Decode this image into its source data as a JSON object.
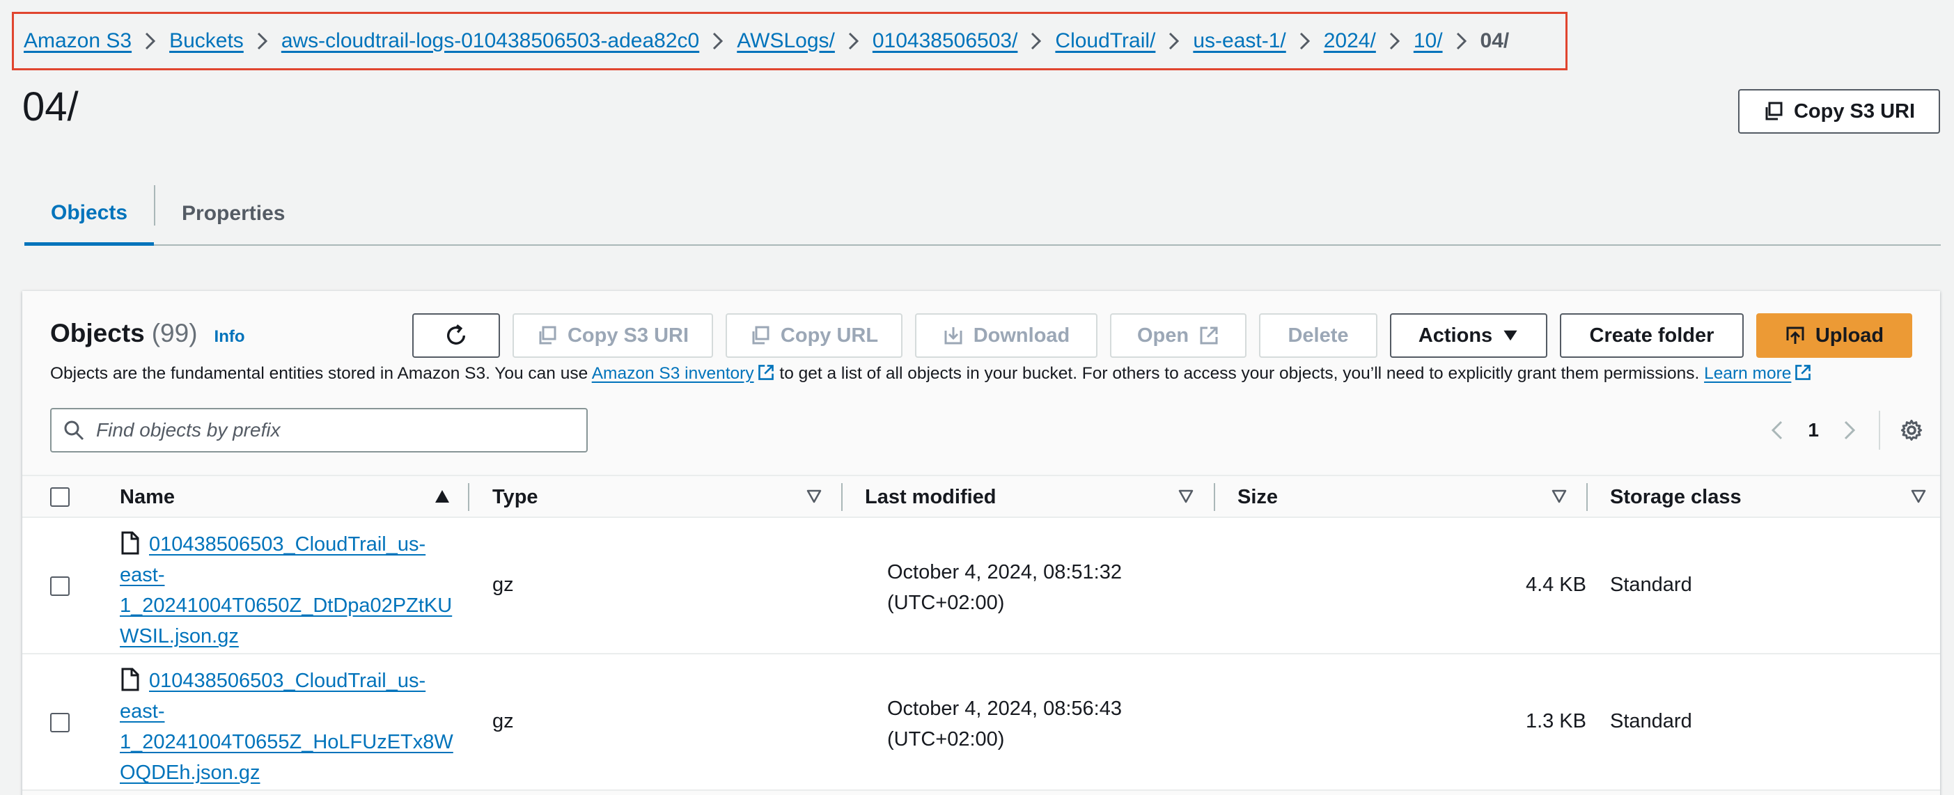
{
  "breadcrumb": {
    "items": [
      "Amazon S3",
      "Buckets",
      "aws-cloudtrail-logs-010438506503-adea82c0",
      "AWSLogs/",
      "010438506503/",
      "CloudTrail/",
      "us-east-1/",
      "2024/",
      "10/"
    ],
    "current": "04/"
  },
  "page": {
    "title": "04/",
    "copy_uri_label": "Copy S3 URI"
  },
  "tabs": [
    {
      "label": "Objects",
      "active": true
    },
    {
      "label": "Properties",
      "active": false
    }
  ],
  "objects_panel": {
    "title": "Objects",
    "count": "(99)",
    "info_label": "Info",
    "toolbar": {
      "copy_s3_uri": "Copy S3 URI",
      "copy_url": "Copy URL",
      "download": "Download",
      "open": "Open",
      "delete": "Delete",
      "actions": "Actions",
      "create_folder": "Create folder",
      "upload": "Upload"
    },
    "description": {
      "part1": "Objects are the fundamental entities stored in Amazon S3. You can use ",
      "link1": "Amazon S3 inventory",
      "part2": " to get a list of all objects in your bucket. For others to access your objects, you’ll need to explicitly grant them permissions. ",
      "link2": "Learn more"
    },
    "search": {
      "placeholder": "Find objects by prefix",
      "value": ""
    },
    "pagination": {
      "current_page": "1"
    }
  },
  "table": {
    "columns": [
      "Name",
      "Type",
      "Last modified",
      "Size",
      "Storage class"
    ],
    "sorted_column": "Name",
    "rows": [
      {
        "name": "010438506503_CloudTrail_us-east-1_20241004T0650Z_DtDpa02PZtKUWSIL.json.gz",
        "name_lines": [
          "010438506503_CloudTrail_us-",
          "east-",
          "1_20241004T0650Z_DtDpa02PZtKU",
          "WSIL.json.gz"
        ],
        "type": "gz",
        "last_modified_line1": "October 4, 2024, 08:51:32",
        "last_modified_line2": "(UTC+02:00)",
        "size": "4.4 KB",
        "storage_class": "Standard"
      },
      {
        "name": "010438506503_CloudTrail_us-east-1_20241004T0655Z_HoLFUzETx8WOQDEh.json.gz",
        "name_lines": [
          "010438506503_CloudTrail_us-",
          "east-",
          "1_20241004T0655Z_HoLFUzETx8W",
          "OQDEh.json.gz"
        ],
        "type": "gz",
        "last_modified_line1": "October 4, 2024, 08:56:43",
        "last_modified_line2": "(UTC+02:00)",
        "size": "1.3 KB",
        "storage_class": "Standard"
      }
    ]
  },
  "colors": {
    "link": "#0073bb",
    "primary_button": "#ec9a35",
    "highlight_box": "#e0452f",
    "background": "#f2f3f3"
  }
}
